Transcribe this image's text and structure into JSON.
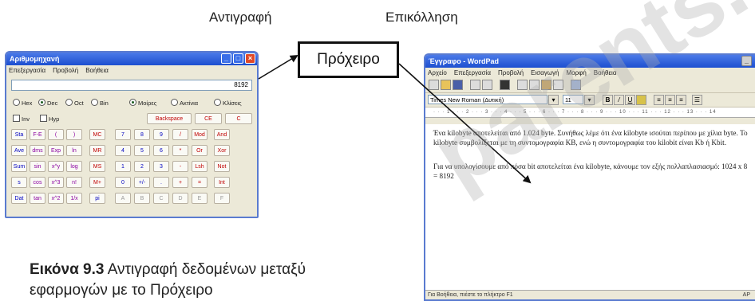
{
  "labels": {
    "copy": "Αντιγραφή",
    "paste": "Επικόλληση",
    "clipboard": "Πρόχειρο"
  },
  "caption": {
    "bold": "Εικόνα 9.3",
    "text": " Αντιγραφή δεδομένων μεταξύ εφαρμογών με το Πρόχειρο"
  },
  "calculator": {
    "title": "Αριθμομηχανή",
    "menu": [
      "Επεξεργασία",
      "Προβολή",
      "Βοήθεια"
    ],
    "display": "8192",
    "radios_left": [
      "Hex",
      "Dec",
      "Oct",
      "Bin"
    ],
    "radios_right": [
      "Μοίρες",
      "Ακτίνια",
      "Κλίσεις"
    ],
    "checks": [
      "Inv",
      "Hyp"
    ],
    "top_keys": [
      "Backspace",
      "CE",
      "C"
    ],
    "sci_keys": [
      [
        "Sta",
        "F-E",
        "(",
        ")"
      ],
      [
        "Ave",
        "dms",
        "Exp",
        "ln"
      ],
      [
        "Sum",
        "sin",
        "x^y",
        "log"
      ],
      [
        "s",
        "cos",
        "x^3",
        "n!"
      ],
      [
        "Dat",
        "tan",
        "x^2",
        "1/x"
      ]
    ],
    "mem_keys": [
      "MC",
      "MR",
      "MS",
      "M+",
      "pi"
    ],
    "num_keys": [
      [
        "7",
        "8",
        "9",
        "/",
        "Mod",
        "And"
      ],
      [
        "4",
        "5",
        "6",
        "*",
        "Or",
        "Xor"
      ],
      [
        "1",
        "2",
        "3",
        "-",
        "Lsh",
        "Not"
      ],
      [
        "0",
        "+/-",
        ".",
        "+",
        "=",
        "Int"
      ],
      [
        "A",
        "B",
        "C",
        "D",
        "E",
        "F"
      ]
    ]
  },
  "wordpad": {
    "title": "Έγγραφο - WordPad",
    "menu": [
      "Αρχείο",
      "Επεξεργασία",
      "Προβολή",
      "Εισαγωγή",
      "Μορφή",
      "Βοήθεια"
    ],
    "font": "Times New Roman (Δυτική)",
    "size": "11",
    "ruler": "· · · 1 · · · 2 · · · 3 · · · 4 · · · 5 · · · 6 · · · 7 · · · 8 · · · 9 · · · 10 · · · 11 · · · 12 · · · 13 · · · 14",
    "paragraph1": "Ένα kilobyte αποτελείται από 1.024 byte. Συνήθως λέμε ότι ένα kilobyte ισούται περίπου με χίλια byte. Το kilobyte συμβολίζεται με τη συντομογραφία KB, ενώ η συντομογραφία του kilobit είναι Kb ή Kbit.",
    "paragraph2": "Για να υπολογίσουμε από πόσα bit αποτελείται ένα kilobyte, κάνουμε τον εξής πολλαπλασιασμό: 1024 x 8 = 8192",
    "status": "Για Βοήθεια, πιέστε το πλήκτρο F1",
    "status_right": "AP"
  },
  "watermark": "parents.gr"
}
